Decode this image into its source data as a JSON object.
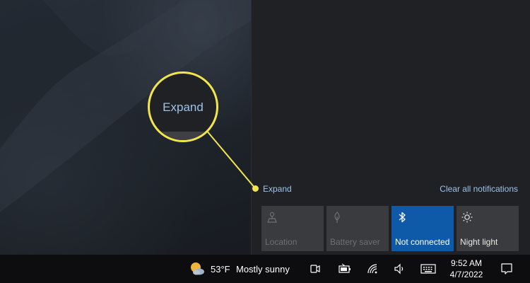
{
  "action_center": {
    "expand_label": "Expand",
    "clear_all_label": "Clear all notifications",
    "quick_actions": [
      {
        "label": "Location",
        "icon": "location-icon",
        "state": "off"
      },
      {
        "label": "Battery saver",
        "icon": "battery-saver-icon",
        "state": "off"
      },
      {
        "label": "Not connected",
        "icon": "bluetooth-icon",
        "state": "on"
      },
      {
        "label": "Night light",
        "icon": "night-light-icon",
        "state": "off"
      }
    ]
  },
  "callout": {
    "zoom_text": "Expand",
    "color": "#f2e64c"
  },
  "taskbar": {
    "weather_temp": "53°F",
    "weather_desc": "Mostly sunny",
    "time": "9:52 AM",
    "date": "4/7/2022",
    "icons": [
      "weather-icon",
      "meet-now-icon",
      "battery-icon",
      "wifi-icon",
      "volume-icon",
      "touch-keyboard-icon",
      "notifications-icon"
    ]
  },
  "colors": {
    "accent": "#0f5aa8",
    "link": "#9cc3ea",
    "tile": "#3a3b3e",
    "taskbar": "#0d0d0f"
  }
}
